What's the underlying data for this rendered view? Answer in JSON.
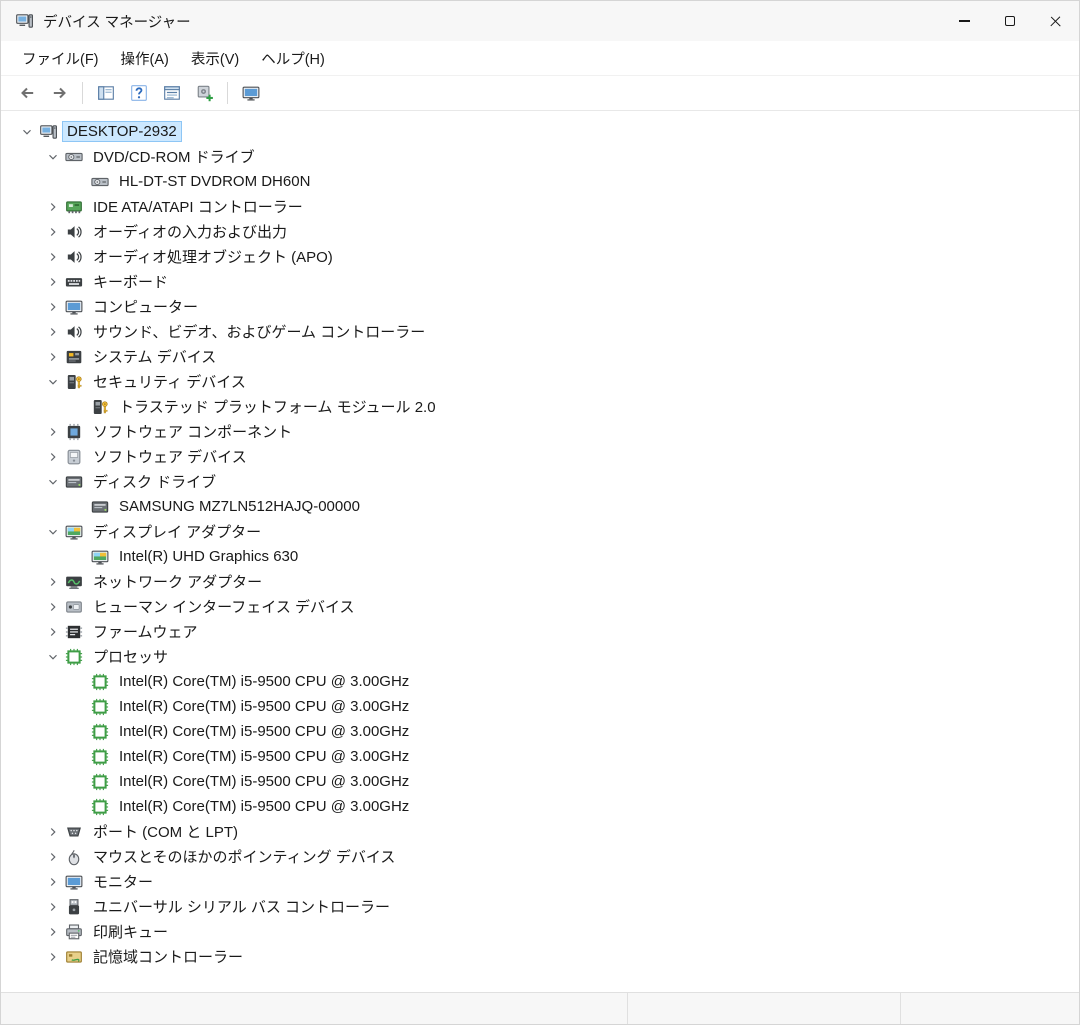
{
  "window": {
    "title": "デバイス マネージャー",
    "controls": [
      {
        "name": "minimize"
      },
      {
        "name": "maximize"
      },
      {
        "name": "close"
      }
    ]
  },
  "menu": {
    "items": [
      {
        "name": "file",
        "label": "ファイル(F)"
      },
      {
        "name": "action",
        "label": "操作(A)"
      },
      {
        "name": "view",
        "label": "表示(V)"
      },
      {
        "name": "help",
        "label": "ヘルプ(H)"
      }
    ]
  },
  "toolbar": {
    "buttons": [
      {
        "name": "back",
        "icon": "arrow-left",
        "sep_after": false
      },
      {
        "name": "forward",
        "icon": "arrow-right",
        "sep_after": true
      },
      {
        "name": "show-hide-console-tree",
        "icon": "console-tree",
        "sep_after": false
      },
      {
        "name": "help",
        "icon": "help",
        "sep_after": false
      },
      {
        "name": "properties",
        "icon": "properties",
        "sep_after": false
      },
      {
        "name": "update-driver",
        "icon": "update-driver",
        "sep_after": true
      },
      {
        "name": "scan-hardware-changes",
        "icon": "scan-monitor",
        "sep_after": false
      }
    ]
  },
  "tree": {
    "items": [
      {
        "level": 0,
        "state": "expanded",
        "icon": "computer",
        "label": "DESKTOP-2932",
        "selected": true
      },
      {
        "level": 1,
        "state": "expanded",
        "icon": "cd-drive",
        "label": "DVD/CD-ROM ドライブ"
      },
      {
        "level": 2,
        "state": "leaf",
        "icon": "cd-drive",
        "label": "HL-DT-ST DVDROM DH60N"
      },
      {
        "level": 1,
        "state": "collapsed",
        "icon": "ide-controller",
        "label": "IDE ATA/ATAPI コントローラー"
      },
      {
        "level": 1,
        "state": "collapsed",
        "icon": "audio",
        "label": "オーディオの入力および出力"
      },
      {
        "level": 1,
        "state": "collapsed",
        "icon": "audio",
        "label": "オーディオ処理オブジェクト (APO)"
      },
      {
        "level": 1,
        "state": "collapsed",
        "icon": "keyboard",
        "label": "キーボード"
      },
      {
        "level": 1,
        "state": "collapsed",
        "icon": "monitor",
        "label": "コンピューター"
      },
      {
        "level": 1,
        "state": "collapsed",
        "icon": "audio",
        "label": "サウンド、ビデオ、およびゲーム コントローラー"
      },
      {
        "level": 1,
        "state": "collapsed",
        "icon": "system-device",
        "label": "システム デバイス"
      },
      {
        "level": 1,
        "state": "expanded",
        "icon": "security",
        "label": "セキュリティ デバイス"
      },
      {
        "level": 2,
        "state": "leaf",
        "icon": "security",
        "label": "トラステッド プラットフォーム モジュール 2.0"
      },
      {
        "level": 1,
        "state": "collapsed",
        "icon": "software-component",
        "label": "ソフトウェア コンポーネント"
      },
      {
        "level": 1,
        "state": "collapsed",
        "icon": "software-device",
        "label": "ソフトウェア デバイス"
      },
      {
        "level": 1,
        "state": "expanded",
        "icon": "disk-drive",
        "label": "ディスク ドライブ"
      },
      {
        "level": 2,
        "state": "leaf",
        "icon": "disk-drive",
        "label": "SAMSUNG MZ7LN512HAJQ-00000"
      },
      {
        "level": 1,
        "state": "expanded",
        "icon": "display-adapter",
        "label": "ディスプレイ アダプター"
      },
      {
        "level": 2,
        "state": "leaf",
        "icon": "display-adapter",
        "label": "Intel(R) UHD Graphics 630"
      },
      {
        "level": 1,
        "state": "collapsed",
        "icon": "network-adapter",
        "label": "ネットワーク アダプター"
      },
      {
        "level": 1,
        "state": "collapsed",
        "icon": "hid",
        "label": "ヒューマン インターフェイス デバイス"
      },
      {
        "level": 1,
        "state": "collapsed",
        "icon": "firmware",
        "label": "ファームウェア"
      },
      {
        "level": 1,
        "state": "expanded",
        "icon": "processor",
        "label": "プロセッサ"
      },
      {
        "level": 2,
        "state": "leaf",
        "icon": "processor",
        "label": "Intel(R) Core(TM) i5-9500 CPU @ 3.00GHz"
      },
      {
        "level": 2,
        "state": "leaf",
        "icon": "processor",
        "label": "Intel(R) Core(TM) i5-9500 CPU @ 3.00GHz"
      },
      {
        "level": 2,
        "state": "leaf",
        "icon": "processor",
        "label": "Intel(R) Core(TM) i5-9500 CPU @ 3.00GHz"
      },
      {
        "level": 2,
        "state": "leaf",
        "icon": "processor",
        "label": "Intel(R) Core(TM) i5-9500 CPU @ 3.00GHz"
      },
      {
        "level": 2,
        "state": "leaf",
        "icon": "processor",
        "label": "Intel(R) Core(TM) i5-9500 CPU @ 3.00GHz"
      },
      {
        "level": 2,
        "state": "leaf",
        "icon": "processor",
        "label": "Intel(R) Core(TM) i5-9500 CPU @ 3.00GHz"
      },
      {
        "level": 1,
        "state": "collapsed",
        "icon": "port",
        "label": "ポート (COM と LPT)"
      },
      {
        "level": 1,
        "state": "collapsed",
        "icon": "mouse",
        "label": "マウスとそのほかのポインティング デバイス"
      },
      {
        "level": 1,
        "state": "collapsed",
        "icon": "monitor",
        "label": "モニター"
      },
      {
        "level": 1,
        "state": "collapsed",
        "icon": "usb",
        "label": "ユニバーサル シリアル バス コントローラー"
      },
      {
        "level": 1,
        "state": "collapsed",
        "icon": "printer",
        "label": "印刷キュー"
      },
      {
        "level": 1,
        "state": "collapsed",
        "icon": "storage-controller",
        "label": "記憶域コントローラー"
      }
    ]
  },
  "colors": {
    "selection_bg": "#cce8ff",
    "selection_border": "#8ec6f5",
    "chrome_bg": "#f7f7f7",
    "processor_green": "#3f9d46"
  }
}
